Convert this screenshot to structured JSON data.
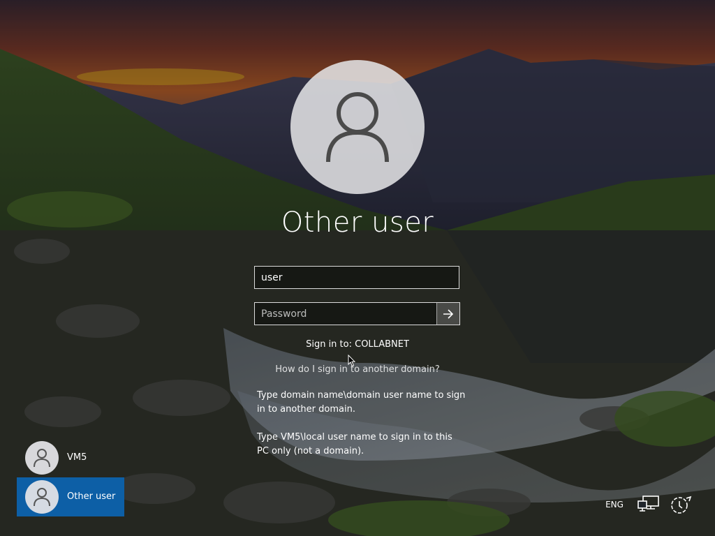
{
  "login": {
    "user_display_name": "Other user",
    "username_value": "user",
    "password_placeholder": "Password",
    "signin_to": "Sign in to: COLLABNET",
    "domain_help_link": "How do I sign in to another domain?",
    "hint_domain": "Type domain name\\domain user name to sign in to another domain.",
    "hint_local": "Type VM5\\local user name to sign in to this PC only (not a domain)."
  },
  "users": [
    {
      "label": "VM5",
      "selected": false
    },
    {
      "label": "Other user",
      "selected": true
    }
  ],
  "tray": {
    "language": "ENG",
    "network_icon": "network-icon",
    "power_icon": "power-icon"
  },
  "colors": {
    "selected_user": "#0d5fa6",
    "avatar_bg": "#e1e1e4"
  }
}
